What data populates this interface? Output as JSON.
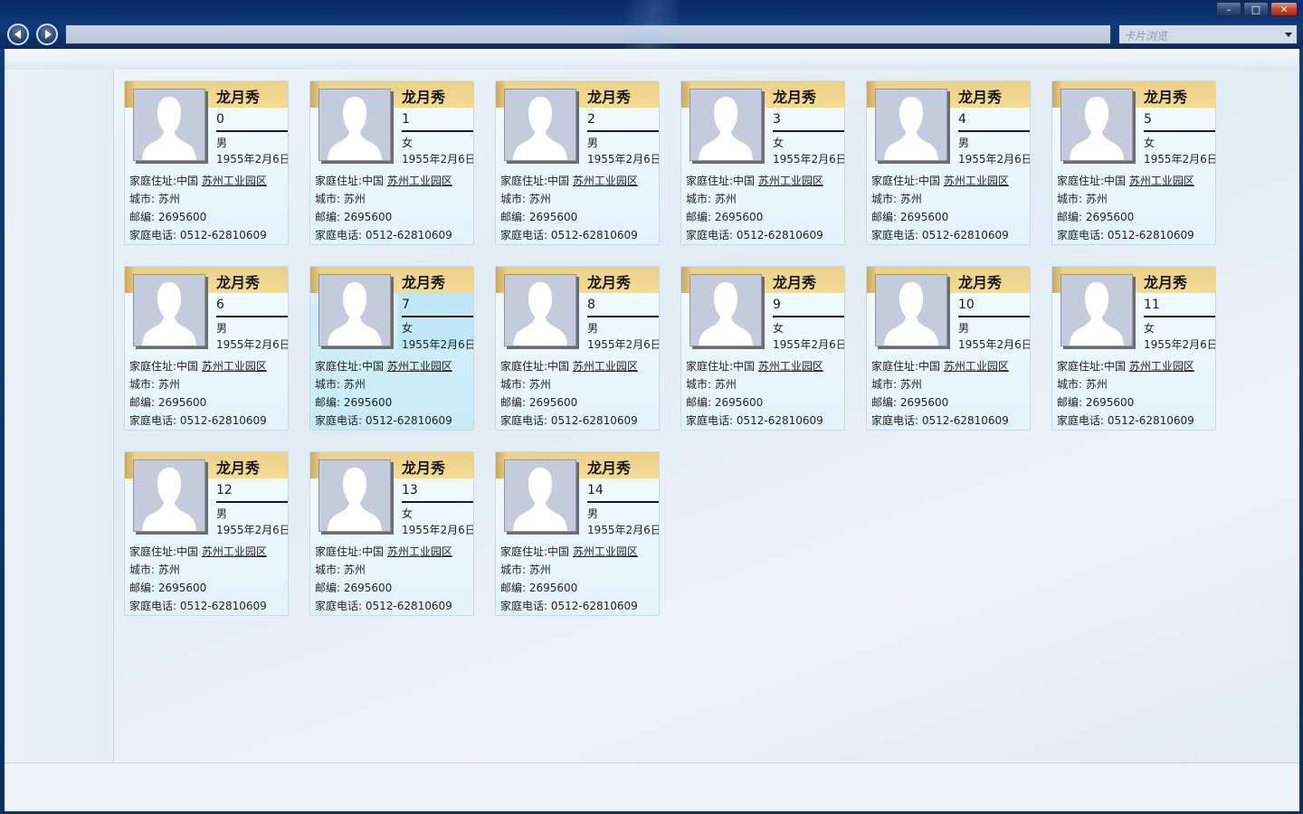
{
  "toolbar": {
    "nav_placeholder": "卡片浏览",
    "minimize": "–",
    "maximize": "□",
    "close": "✕"
  },
  "card_labels": {
    "address_prefix": "家庭住址:中国 ",
    "address_link": "苏州工业园区",
    "city": "城市: 苏州",
    "zip": "邮编: 2695600",
    "phone": "家庭电话: 0512-62810609"
  },
  "cards": [
    {
      "name": "龙月秀",
      "num": "0",
      "gender": "男",
      "birth": "1955年2月6日"
    },
    {
      "name": "龙月秀",
      "num": "1",
      "gender": "女",
      "birth": "1955年2月6日"
    },
    {
      "name": "龙月秀",
      "num": "2",
      "gender": "男",
      "birth": "1955年2月6日"
    },
    {
      "name": "龙月秀",
      "num": "3",
      "gender": "女",
      "birth": "1955年2月6日"
    },
    {
      "name": "龙月秀",
      "num": "4",
      "gender": "男",
      "birth": "1955年2月6日"
    },
    {
      "name": "龙月秀",
      "num": "5",
      "gender": "女",
      "birth": "1955年2月6日"
    },
    {
      "name": "龙月秀",
      "num": "6",
      "gender": "男",
      "birth": "1955年2月6日"
    },
    {
      "name": "龙月秀",
      "num": "7",
      "gender": "女",
      "birth": "1955年2月6日",
      "selected": true
    },
    {
      "name": "龙月秀",
      "num": "8",
      "gender": "男",
      "birth": "1955年2月6日"
    },
    {
      "name": "龙月秀",
      "num": "9",
      "gender": "女",
      "birth": "1955年2月6日"
    },
    {
      "name": "龙月秀",
      "num": "10",
      "gender": "男",
      "birth": "1955年2月6日"
    },
    {
      "name": "龙月秀",
      "num": "11",
      "gender": "女",
      "birth": "1955年2月6日"
    },
    {
      "name": "龙月秀",
      "num": "12",
      "gender": "男",
      "birth": "1955年2月6日"
    },
    {
      "name": "龙月秀",
      "num": "13",
      "gender": "女",
      "birth": "1955年2月6日"
    },
    {
      "name": "龙月秀",
      "num": "14",
      "gender": "男",
      "birth": "1955年2月6日"
    }
  ],
  "colors": {
    "title_bar": "#0f3a7a",
    "card_band": "#f3dc93",
    "card_bg": "#e3f3fb",
    "card_selected_bg": "#c8ebf8"
  }
}
